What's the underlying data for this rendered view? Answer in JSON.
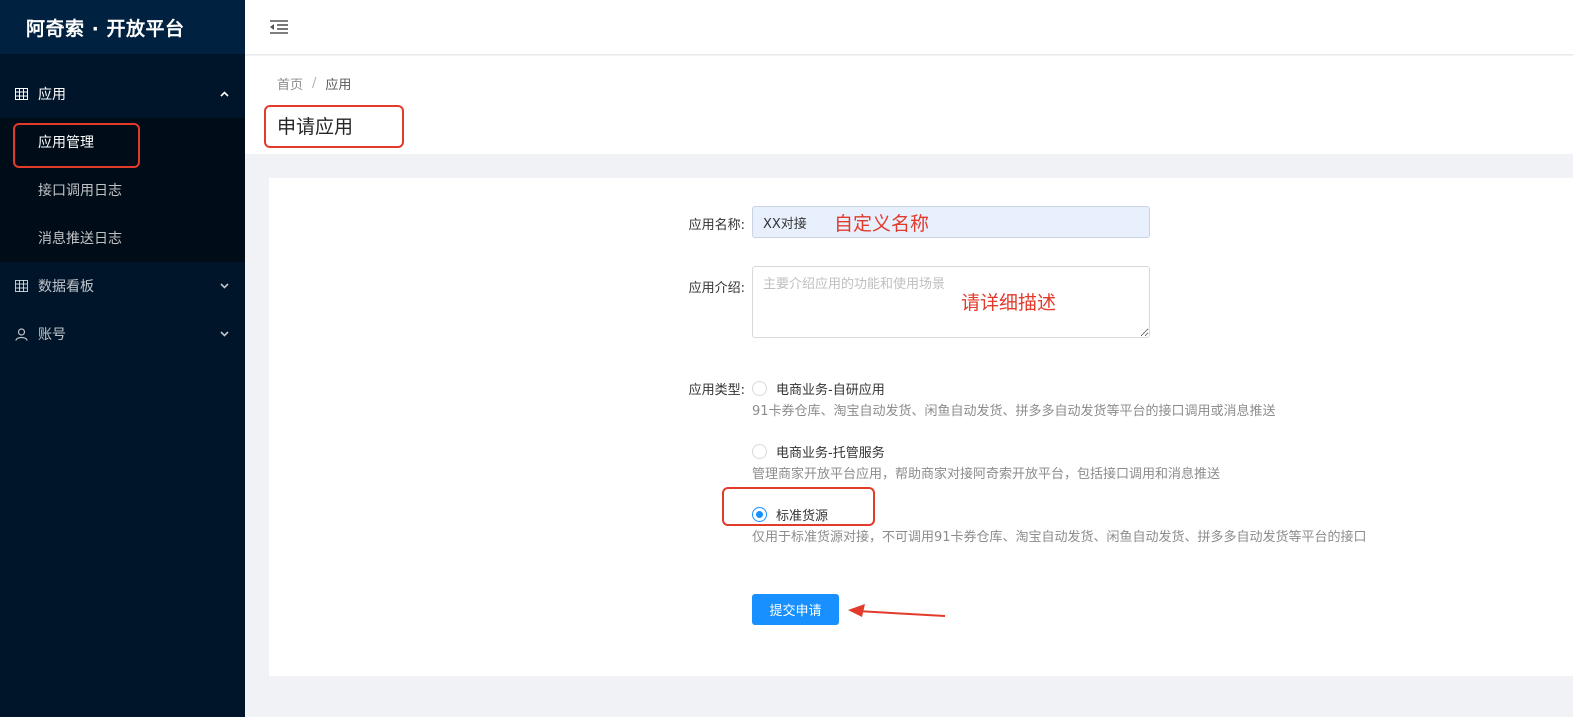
{
  "app": {
    "title": "阿奇索 · 开放平台"
  },
  "sidebar": {
    "menu_app": "应用",
    "submenu": [
      {
        "label": "应用管理"
      },
      {
        "label": "接口调用日志"
      },
      {
        "label": "消息推送日志"
      }
    ],
    "menu_dashboard": "数据看板",
    "menu_account": "账号"
  },
  "breadcrumb": {
    "home": "首页",
    "sep": "/",
    "current": "应用"
  },
  "page": {
    "title": "申请应用"
  },
  "form": {
    "name_label": "应用名称:",
    "name_value": "XX对接",
    "intro_label": "应用介绍:",
    "intro_placeholder": "主要介绍应用的功能和使用场景",
    "type_label": "应用类型:",
    "types": [
      {
        "label": "电商业务-自研应用",
        "desc": "91卡券仓库、淘宝自动发货、闲鱼自动发货、拼多多自动发货等平台的接口调用或消息推送",
        "checked": false
      },
      {
        "label": "电商业务-托管服务",
        "desc": "管理商家开放平台应用，帮助商家对接阿奇索开放平台，包括接口调用和消息推送",
        "checked": false
      },
      {
        "label": "标准货源",
        "desc": "仅用于标准货源对接，不可调用91卡券仓库、淘宝自动发货、闲鱼自动发货、拼多多自动发货等平台的接口",
        "checked": true
      }
    ],
    "submit_label": "提交申请"
  },
  "annotations": {
    "name_hint": "自定义名称",
    "intro_hint": "请详细描述",
    "color": "#e23a2b"
  },
  "colors": {
    "sidebar_bg": "#001529",
    "primary": "#1890ff"
  }
}
